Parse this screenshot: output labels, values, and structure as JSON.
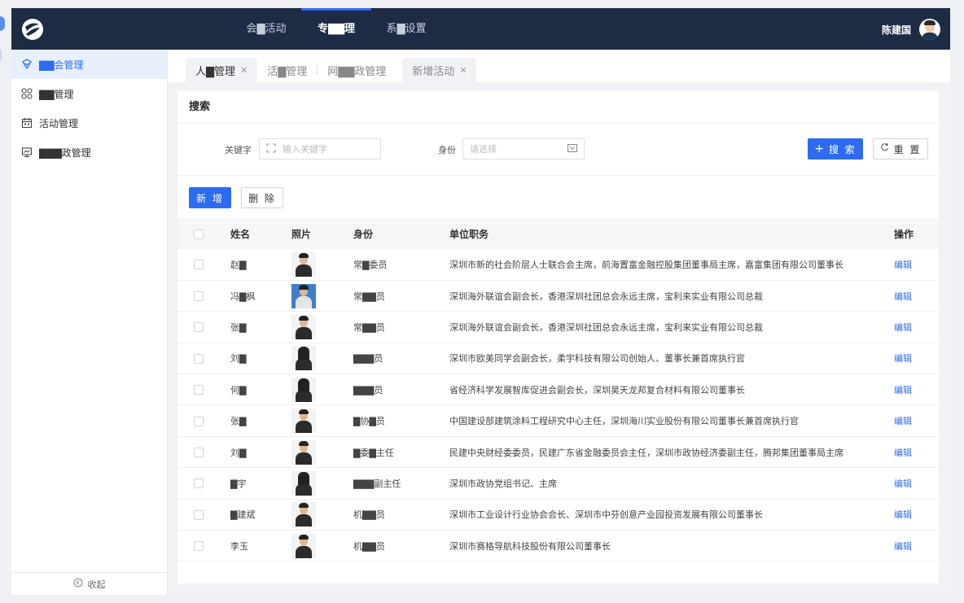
{
  "header": {
    "nav": [
      {
        "label": "会▇活动"
      },
      {
        "label": "专▇▇理"
      },
      {
        "label": "系▇设置"
      }
    ],
    "user_name": "陈建国"
  },
  "sidebar": {
    "items": [
      {
        "label": "▇▇会管理",
        "icon": "heart-shield-icon"
      },
      {
        "label": "▇▇管理",
        "icon": "apps-icon"
      },
      {
        "label": "活动管理",
        "icon": "calendar-icon"
      },
      {
        "label": "▇▇▇政管理",
        "icon": "monitor-icon"
      }
    ],
    "collapse_label": "收起"
  },
  "tabs": [
    {
      "label": "人▇管理",
      "closable": true
    },
    {
      "label": "活▇管理",
      "closable": false
    },
    {
      "label": "网▇▇政管理",
      "closable": false
    },
    {
      "label": "新增活动",
      "closable": true
    }
  ],
  "search": {
    "title": "搜索",
    "keyword_label": "关键字",
    "keyword_placeholder": "输入关键字",
    "identity_label": "身份",
    "identity_placeholder": "请选择",
    "search_button": "搜 索",
    "reset_button": "重 置"
  },
  "actions": {
    "add_button": "新 增",
    "delete_button": "删 除"
  },
  "table": {
    "columns": [
      "姓名",
      "照片",
      "身份",
      "单位职务",
      "操作"
    ],
    "edit_label": "编辑",
    "rows": [
      {
        "name": "赵▇",
        "identity": "常▇委员",
        "position": "深圳市新的社会阶层人士联合会主席，前海置富金融控股集团董事局主席，嘉富集团有限公司董事长"
      },
      {
        "name": "冯▇枫",
        "identity": "常▇▇员",
        "position": "深圳海外联谊会副会长，香港深圳社团总会永远主席，宝利来实业有限公司总裁"
      },
      {
        "name": "张▇",
        "identity": "常▇▇员",
        "position": "深圳海外联谊会副会长，香港深圳社团总会永远主席，宝利来实业有限公司总裁"
      },
      {
        "name": "刘▇",
        "identity": "▇▇▇员",
        "position": "深圳市欧美同学会副会长，柔宇科技有限公司创始人、董事长兼首席执行官"
      },
      {
        "name": "何▇",
        "identity": "▇▇▇员",
        "position": "省经济科学发展智库促进会副会长，深圳昊天龙邦复合材料有限公司董事长"
      },
      {
        "name": "张▇",
        "identity": "▇协▇员",
        "position": "中国建设部建筑涂料工程研究中心主任，深圳海川实业股份有限公司董事长兼首席执行官"
      },
      {
        "name": "刘▇",
        "identity": "▇委▇主任",
        "position": "民建中央财经委委员，民建广东省金融委员会主任，深圳市政协经济委副主任，腾邦集团董事局主席"
      },
      {
        "name": "▇宇",
        "identity": "▇▇▇副主任",
        "position": "深圳市政协党组书记、主席"
      },
      {
        "name": "▇建斌",
        "identity": "机▇▇员",
        "position": "深圳市工业设计行业协会会长、深圳市中芬创意产业园投资发展有限公司董事长"
      },
      {
        "name": "李玉",
        "identity": "机▇▇员",
        "position": "深圳市赛格导航科技股份有限公司董事长"
      }
    ]
  },
  "colors": {
    "topbar": "#1d2b45",
    "accent": "#2d6cf0"
  }
}
